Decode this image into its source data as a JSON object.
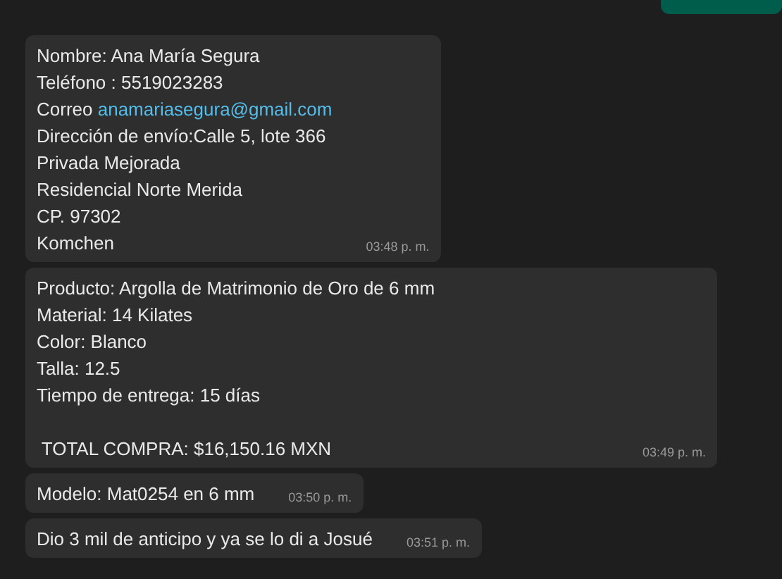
{
  "messages": [
    {
      "outgoing": true
    },
    {
      "outgoing": false,
      "lines": [
        {
          "text": "Nombre: Ana María Segura"
        },
        {
          "text": "Teléfono : 5519023283"
        },
        {
          "text": "Correo ",
          "link": "anamariasegura@gmail.com"
        },
        {
          "text": "Dirección de envío:Calle 5, lote 366"
        },
        {
          "text": "Privada Mejorada"
        },
        {
          "text": "Residencial Norte Merida"
        },
        {
          "text": "CP. 97302"
        },
        {
          "text": "Komchen"
        }
      ],
      "time": "03:48 p. m."
    },
    {
      "outgoing": false,
      "lines": [
        {
          "text": "Producto: Argolla de Matrimonio de Oro de 6 mm"
        },
        {
          "text": "Material: 14 Kilates"
        },
        {
          "text": "Color: Blanco"
        },
        {
          "text": "Talla: 12.5"
        },
        {
          "text": "Tiempo de entrega: 15 días"
        },
        {
          "text": " TOTAL COMPRA: $16,150.16 MXN",
          "spaced": true
        }
      ],
      "time": "03:49 p. m."
    },
    {
      "outgoing": false,
      "lines": [
        {
          "text": "Modelo: Mat0254 en 6 mm"
        }
      ],
      "time": "03:50 p. m."
    },
    {
      "outgoing": false,
      "lines": [
        {
          "text": "Dio 3 mil de anticipo y ya se lo di a Josué"
        }
      ],
      "time": "03:51 p. m."
    }
  ]
}
